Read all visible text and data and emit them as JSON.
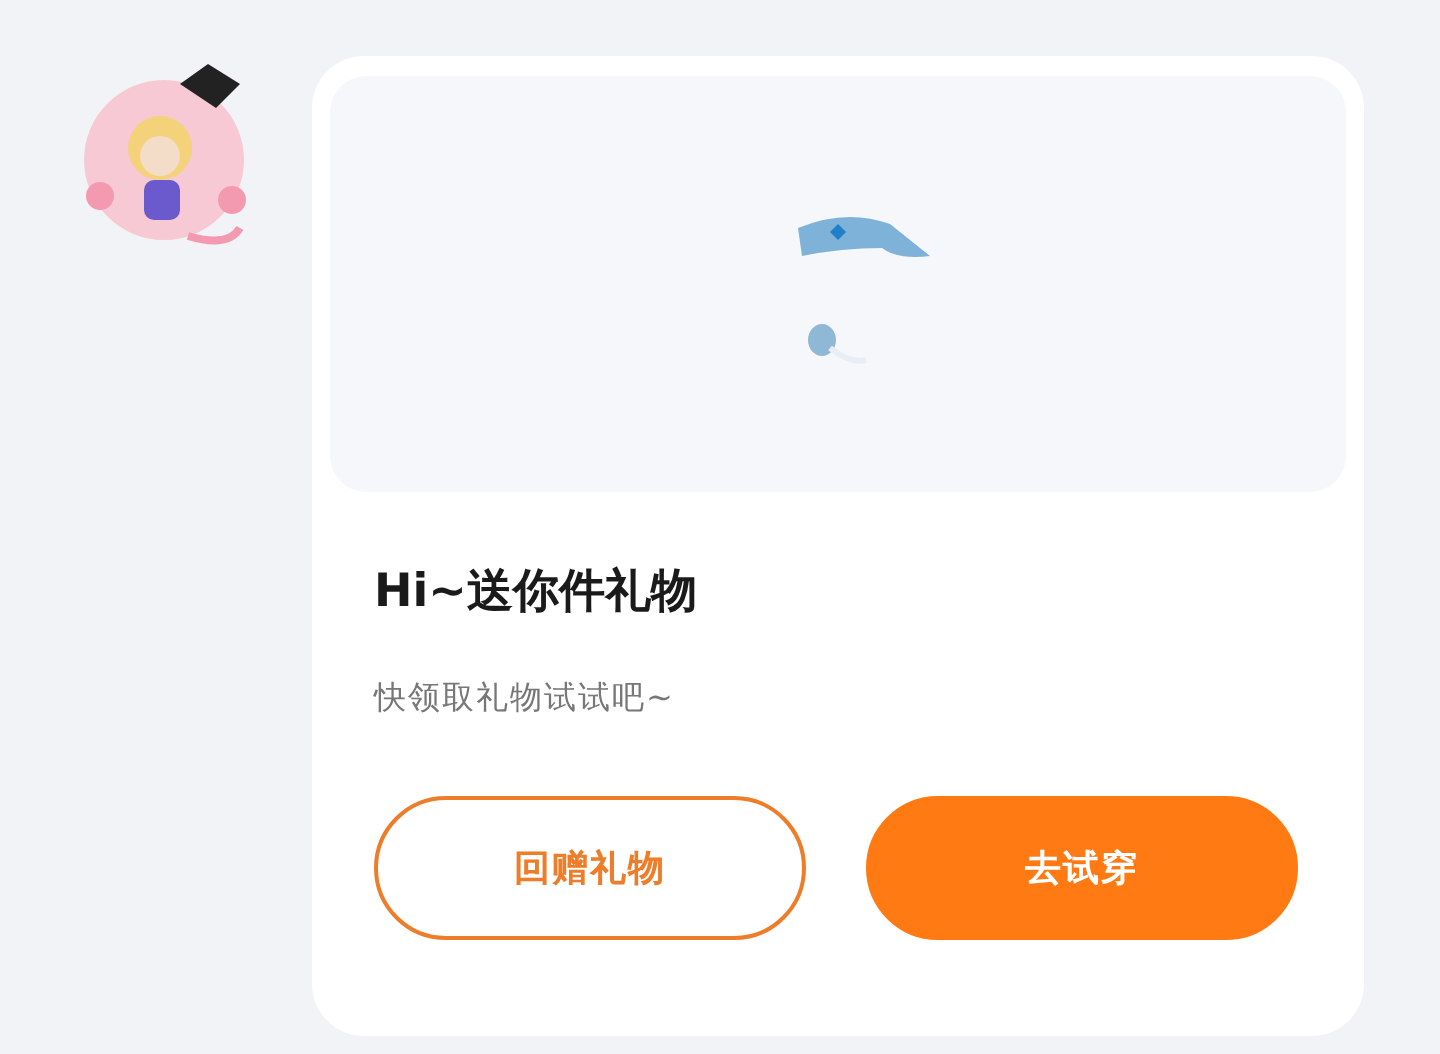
{
  "gift": {
    "title": "Hi~送你件礼物",
    "message": "快领取礼物试试吧~"
  },
  "buttons": [
    {
      "label": "回赠礼物",
      "kind": "outline"
    },
    {
      "label": "去试穿",
      "kind": "filled"
    }
  ]
}
